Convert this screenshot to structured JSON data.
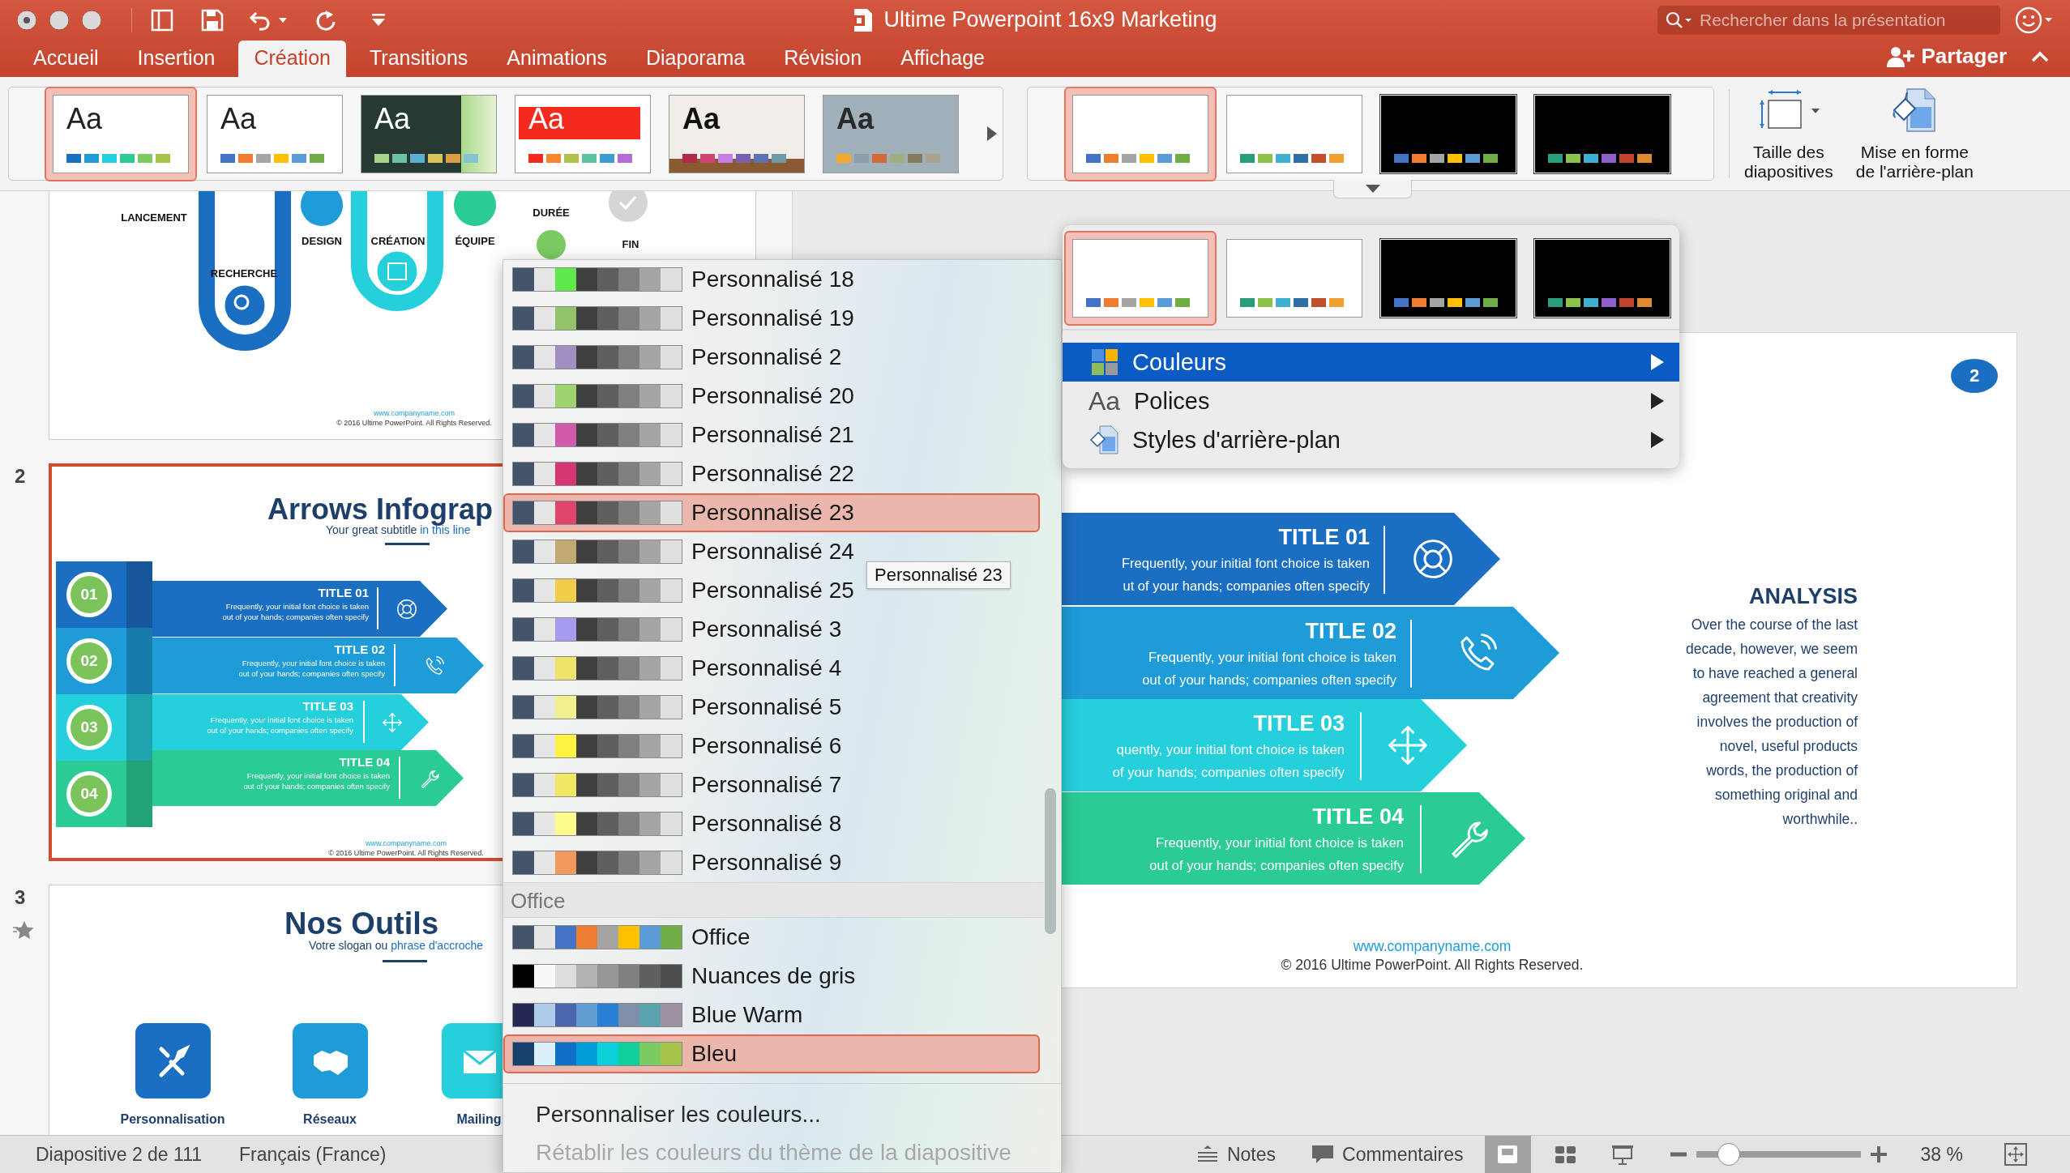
{
  "window": {
    "title": "Ultime Powerpoint 16x9 Marketing",
    "search": {
      "placeholder": "Rechercher dans la présentation"
    }
  },
  "tabs": [
    {
      "label": "Accueil",
      "selected": false
    },
    {
      "label": "Insertion",
      "selected": false
    },
    {
      "label": "Création",
      "selected": true
    },
    {
      "label": "Transitions",
      "selected": false
    },
    {
      "label": "Animations",
      "selected": false
    },
    {
      "label": "Diaporama",
      "selected": false
    },
    {
      "label": "Révision",
      "selected": false
    },
    {
      "label": "Affichage",
      "selected": false
    }
  ],
  "share": {
    "label": "Partager"
  },
  "ribbon": {
    "themes": [
      {
        "label": "Aa",
        "kind": "white",
        "selected": true,
        "swatches": [
          {
            "color": "#1b6fc2"
          },
          {
            "color": "#1e9cd8"
          },
          {
            "color": "#26cfdc"
          },
          {
            "color": "#2acb94"
          },
          {
            "color": "#7cca62"
          },
          {
            "color": "#a5c249"
          }
        ]
      },
      {
        "label": "Aa",
        "kind": "white",
        "selected": false,
        "swatches": [
          {
            "color": "#4472c4"
          },
          {
            "color": "#ed7d31"
          },
          {
            "color": "#a5a5a5"
          },
          {
            "color": "#ffc000"
          },
          {
            "color": "#5b9bd5"
          },
          {
            "color": "#70ad47"
          }
        ]
      },
      {
        "label": "Aa",
        "kind": "dark-green",
        "selected": false,
        "swatches": [
          {
            "color": "#a5d48a"
          },
          {
            "color": "#6ac2a0"
          },
          {
            "color": "#5bb0cf"
          },
          {
            "color": "#d7c55a"
          },
          {
            "color": "#dba046"
          },
          {
            "color": "#84c4d0"
          }
        ]
      },
      {
        "label": "Aa",
        "kind": "red",
        "selected": false,
        "swatches": [
          {
            "color": "#f52a1f"
          },
          {
            "color": "#f88530"
          },
          {
            "color": "#b0c04d"
          },
          {
            "color": "#5bc3a2"
          },
          {
            "color": "#3d9bd3"
          },
          {
            "color": "#b56bd6"
          }
        ]
      },
      {
        "label": "Aa",
        "kind": "beige",
        "selected": false,
        "swatches": [
          {
            "color": "#b22a4b"
          },
          {
            "color": "#d1466f"
          },
          {
            "color": "#c77ee6"
          },
          {
            "color": "#7b5fb0"
          },
          {
            "color": "#5c71b4"
          },
          {
            "color": "#6f98a8"
          }
        ]
      },
      {
        "label": "Aa",
        "kind": "slate",
        "selected": false,
        "swatches": [
          {
            "color": "#f0a830"
          },
          {
            "color": "#8c9eab"
          },
          {
            "color": "#d26a3b"
          },
          {
            "color": "#a0ae84"
          },
          {
            "color": "#857a5c"
          },
          {
            "color": "#a8a18b"
          }
        ]
      }
    ],
    "variants": [
      {
        "kind": "light",
        "selected": true,
        "swatches": [
          {
            "color": "#4472c4"
          },
          {
            "color": "#ed7d31"
          },
          {
            "color": "#a5a5a5"
          },
          {
            "color": "#ffc000"
          },
          {
            "color": "#5b9bd5"
          },
          {
            "color": "#70ad47"
          }
        ]
      },
      {
        "kind": "light",
        "selected": false,
        "swatches": [
          {
            "color": "#2a9d7d"
          },
          {
            "color": "#8bc34a"
          },
          {
            "color": "#3fb0d0"
          },
          {
            "color": "#2f6ea6"
          },
          {
            "color": "#c0502d"
          },
          {
            "color": "#f0a030"
          }
        ]
      },
      {
        "kind": "dark",
        "selected": false,
        "swatches": [
          {
            "color": "#4472c4"
          },
          {
            "color": "#ed7d31"
          },
          {
            "color": "#a5a5a5"
          },
          {
            "color": "#ffc000"
          },
          {
            "color": "#5b9bd5"
          },
          {
            "color": "#70ad47"
          }
        ]
      },
      {
        "kind": "dark",
        "selected": false,
        "swatches": [
          {
            "color": "#2a9d7d"
          },
          {
            "color": "#8bc34a"
          },
          {
            "color": "#3fb0d0"
          },
          {
            "color": "#8d5fc8"
          },
          {
            "color": "#c0442d"
          },
          {
            "color": "#dc8c30"
          }
        ]
      }
    ],
    "buttons": [
      {
        "kind": "slide-size",
        "label": "Taille des\ndiapositives"
      },
      {
        "kind": "background-format",
        "label": "Mise en forme\nde l'arrière-plan"
      }
    ]
  },
  "slides": [
    {
      "kind": "timeline",
      "selected": false,
      "labels": [
        "LANCEMENT",
        "RECHERCHE",
        "DESIGN",
        "CRÉATION",
        "ÉQUIPE",
        "DURÉE",
        "FIN"
      ],
      "footer": {
        "url": "www.companyname.com",
        "copyright": "© 2016 Ultime PowerPoint. All Rights Reserved."
      }
    },
    {
      "kind": "arrows",
      "number": "2",
      "selected": true,
      "title": "Arrows Infograp",
      "subtitle": "Your great subtitle",
      "subtitle_accent": "in this line",
      "rows": [
        {
          "number": "01",
          "title": "TITLE 01",
          "text": "Frequently, your initial font choice is taken\nout of your hands; companies often specify"
        },
        {
          "number": "02",
          "title": "TITLE 02",
          "text": "Frequently, your initial font choice is taken\nout of your hands; companies often specify"
        },
        {
          "number": "03",
          "title": "TITLE 03",
          "text": "Frequently, your initial font choice is taken\nout of your hands; companies often specify"
        },
        {
          "number": "04",
          "title": "TITLE 04",
          "text": "Frequently, your initial font choice is taken\nout of your hands; companies often specify"
        }
      ],
      "footer": {
        "url": "www.companyname.com",
        "copyright": "© 2016 Ultime PowerPoint. All Rights Reserved."
      }
    },
    {
      "kind": "tools",
      "number": "3",
      "selected": false,
      "title": "Nos Outils",
      "subtitle": "Votre slogan ou",
      "subtitle_accent": "phrase d'accroche",
      "tools": [
        {
          "label": "Personnalisation"
        },
        {
          "label": "Réseaux"
        },
        {
          "label": "Mailing"
        }
      ]
    }
  ],
  "slide": {
    "badge": "2",
    "rows": [
      {
        "title": "TITLE 01",
        "text": "Frequently, your initial font choice is taken\nut of your hands; companies often specify"
      },
      {
        "title": "TITLE 02",
        "text": "Frequently, your initial font choice is taken\nout of your hands; companies often specify"
      },
      {
        "title": "TITLE 03",
        "text": "quently, your initial font choice is taken\nof your hands; companies often specify"
      },
      {
        "title": "TITLE 04",
        "text": "Frequently, your initial font choice is taken\nout of your hands; companies often specify"
      }
    ],
    "analysis": {
      "title": "ANALYSIS",
      "text": "Over the course of the last\ndecade, however, we seem\nto have reached a general\nagreement that creativity\ninvolves the production of\nnovel, useful products\nwords, the production of\nsomething original and\nworthwhile.."
    },
    "footer": {
      "url": "www.companyname.com",
      "copyright": "© 2016 Ultime PowerPoint. All Rights Reserved."
    }
  },
  "color_menu": {
    "palettes": [
      {
        "kind": "palette",
        "label": "Personnalisé 18",
        "selected": false,
        "swatches": [
          {
            "color": "#44546a"
          },
          {
            "color": "#e7e6e6"
          },
          {
            "color": "#5ee84c"
          },
          {
            "color": "#404040"
          },
          {
            "color": "#5f5f5f"
          },
          {
            "color": "#808080"
          },
          {
            "color": "#a5a5a5"
          },
          {
            "color": "#e0e0e0"
          }
        ]
      },
      {
        "kind": "palette",
        "label": "Personnalisé 19",
        "selected": false,
        "swatches": [
          {
            "color": "#44546a"
          },
          {
            "color": "#e7e6e6"
          },
          {
            "color": "#92c36a"
          },
          {
            "color": "#404040"
          },
          {
            "color": "#5f5f5f"
          },
          {
            "color": "#808080"
          },
          {
            "color": "#a5a5a5"
          },
          {
            "color": "#e0e0e0"
          }
        ]
      },
      {
        "kind": "palette",
        "label": "Personnalisé 2",
        "selected": false,
        "swatches": [
          {
            "color": "#44546a"
          },
          {
            "color": "#e7e6e6"
          },
          {
            "color": "#a18fc2"
          },
          {
            "color": "#404040"
          },
          {
            "color": "#5f5f5f"
          },
          {
            "color": "#808080"
          },
          {
            "color": "#a5a5a5"
          },
          {
            "color": "#e0e0e0"
          }
        ]
      },
      {
        "kind": "palette",
        "label": "Personnalisé 20",
        "selected": false,
        "swatches": [
          {
            "color": "#44546a"
          },
          {
            "color": "#e7e6e6"
          },
          {
            "color": "#9ed36f"
          },
          {
            "color": "#404040"
          },
          {
            "color": "#5f5f5f"
          },
          {
            "color": "#808080"
          },
          {
            "color": "#a5a5a5"
          },
          {
            "color": "#e0e0e0"
          }
        ]
      },
      {
        "kind": "palette",
        "label": "Personnalisé 21",
        "selected": false,
        "swatches": [
          {
            "color": "#44546a"
          },
          {
            "color": "#e7e6e6"
          },
          {
            "color": "#d25aad"
          },
          {
            "color": "#404040"
          },
          {
            "color": "#5f5f5f"
          },
          {
            "color": "#808080"
          },
          {
            "color": "#a5a5a5"
          },
          {
            "color": "#e0e0e0"
          }
        ]
      },
      {
        "kind": "palette",
        "label": "Personnalisé 22",
        "selected": false,
        "swatches": [
          {
            "color": "#44546a"
          },
          {
            "color": "#e7e6e6"
          },
          {
            "color": "#d63672"
          },
          {
            "color": "#404040"
          },
          {
            "color": "#5f5f5f"
          },
          {
            "color": "#808080"
          },
          {
            "color": "#a5a5a5"
          },
          {
            "color": "#e0e0e0"
          }
        ]
      },
      {
        "kind": "palette",
        "label": "Personnalisé 23",
        "selected": true,
        "swatches": [
          {
            "color": "#44546a"
          },
          {
            "color": "#e7e6e6"
          },
          {
            "color": "#e2456b"
          },
          {
            "color": "#404040"
          },
          {
            "color": "#5f5f5f"
          },
          {
            "color": "#808080"
          },
          {
            "color": "#a5a5a5"
          },
          {
            "color": "#e0e0e0"
          }
        ]
      },
      {
        "kind": "palette",
        "label": "Personnalisé 24",
        "selected": false,
        "swatches": [
          {
            "color": "#44546a"
          },
          {
            "color": "#e7e6e6"
          },
          {
            "color": "#c1a970"
          },
          {
            "color": "#404040"
          },
          {
            "color": "#5f5f5f"
          },
          {
            "color": "#808080"
          },
          {
            "color": "#a5a5a5"
          },
          {
            "color": "#e0e0e0"
          }
        ]
      },
      {
        "kind": "palette",
        "label": "Personnalisé 25",
        "selected": false,
        "swatches": [
          {
            "color": "#44546a"
          },
          {
            "color": "#e7e6e6"
          },
          {
            "color": "#f2cd4a"
          },
          {
            "color": "#404040"
          },
          {
            "color": "#5f5f5f"
          },
          {
            "color": "#808080"
          },
          {
            "color": "#a5a5a5"
          },
          {
            "color": "#e0e0e0"
          }
        ]
      },
      {
        "kind": "palette",
        "label": "Personnalisé 3",
        "selected": false,
        "swatches": [
          {
            "color": "#44546a"
          },
          {
            "color": "#e7e6e6"
          },
          {
            "color": "#a59cf0"
          },
          {
            "color": "#404040"
          },
          {
            "color": "#5f5f5f"
          },
          {
            "color": "#808080"
          },
          {
            "color": "#a5a5a5"
          },
          {
            "color": "#e0e0e0"
          }
        ]
      },
      {
        "kind": "palette",
        "label": "Personnalisé 4",
        "selected": false,
        "swatches": [
          {
            "color": "#44546a"
          },
          {
            "color": "#e7e6e6"
          },
          {
            "color": "#eee46c"
          },
          {
            "color": "#404040"
          },
          {
            "color": "#5f5f5f"
          },
          {
            "color": "#808080"
          },
          {
            "color": "#a5a5a5"
          },
          {
            "color": "#e0e0e0"
          }
        ]
      },
      {
        "kind": "palette",
        "label": "Personnalisé 5",
        "selected": false,
        "swatches": [
          {
            "color": "#44546a"
          },
          {
            "color": "#e7e6e6"
          },
          {
            "color": "#f0f08e"
          },
          {
            "color": "#404040"
          },
          {
            "color": "#5f5f5f"
          },
          {
            "color": "#808080"
          },
          {
            "color": "#a5a5a5"
          },
          {
            "color": "#e0e0e0"
          }
        ]
      },
      {
        "kind": "palette",
        "label": "Personnalisé 6",
        "selected": false,
        "swatches": [
          {
            "color": "#44546a"
          },
          {
            "color": "#e7e6e6"
          },
          {
            "color": "#fef243"
          },
          {
            "color": "#404040"
          },
          {
            "color": "#5f5f5f"
          },
          {
            "color": "#808080"
          },
          {
            "color": "#a5a5a5"
          },
          {
            "color": "#e0e0e0"
          }
        ]
      },
      {
        "kind": "palette",
        "label": "Personnalisé 7",
        "selected": false,
        "swatches": [
          {
            "color": "#44546a"
          },
          {
            "color": "#e7e6e6"
          },
          {
            "color": "#f0e862"
          },
          {
            "color": "#404040"
          },
          {
            "color": "#5f5f5f"
          },
          {
            "color": "#808080"
          },
          {
            "color": "#a5a5a5"
          },
          {
            "color": "#e0e0e0"
          }
        ]
      },
      {
        "kind": "palette",
        "label": "Personnalisé 8",
        "selected": false,
        "swatches": [
          {
            "color": "#44546a"
          },
          {
            "color": "#e7e6e6"
          },
          {
            "color": "#fdfb8c"
          },
          {
            "color": "#404040"
          },
          {
            "color": "#5f5f5f"
          },
          {
            "color": "#808080"
          },
          {
            "color": "#a5a5a5"
          },
          {
            "color": "#e0e0e0"
          }
        ]
      },
      {
        "kind": "palette",
        "label": "Personnalisé 9",
        "selected": false,
        "swatches": [
          {
            "color": "#44546a"
          },
          {
            "color": "#e7e6e6"
          },
          {
            "color": "#f2985a"
          },
          {
            "color": "#404040"
          },
          {
            "color": "#5f5f5f"
          },
          {
            "color": "#808080"
          },
          {
            "color": "#a5a5a5"
          },
          {
            "color": "#e0e0e0"
          }
        ]
      },
      {
        "kind": "header",
        "label": "Office"
      },
      {
        "kind": "palette",
        "label": "Office",
        "selected": false,
        "swatches": [
          {
            "color": "#44546a"
          },
          {
            "color": "#e7e6e6"
          },
          {
            "color": "#4472c4"
          },
          {
            "color": "#ed7d31"
          },
          {
            "color": "#a5a5a5"
          },
          {
            "color": "#ffc000"
          },
          {
            "color": "#5b9bd5"
          },
          {
            "color": "#70ad47"
          }
        ]
      },
      {
        "kind": "palette",
        "label": "Nuances de gris",
        "selected": false,
        "swatches": [
          {
            "color": "#000000"
          },
          {
            "color": "#f8f8f8"
          },
          {
            "color": "#dddddd"
          },
          {
            "color": "#b2b2b2"
          },
          {
            "color": "#969696"
          },
          {
            "color": "#808080"
          },
          {
            "color": "#5f5f5f"
          },
          {
            "color": "#4d4d4d"
          }
        ]
      },
      {
        "kind": "palette",
        "label": "Blue Warm",
        "selected": false,
        "swatches": [
          {
            "color": "#242852"
          },
          {
            "color": "#acccea"
          },
          {
            "color": "#4a66ac"
          },
          {
            "color": "#629dd1"
          },
          {
            "color": "#297fd5"
          },
          {
            "color": "#7f8fa9"
          },
          {
            "color": "#5aa2ae"
          },
          {
            "color": "#9d90a0"
          }
        ]
      },
      {
        "kind": "palette",
        "label": "Bleu",
        "selected": true,
        "swatches": [
          {
            "color": "#17406d"
          },
          {
            "color": "#dbeff9"
          },
          {
            "color": "#0f6fc6"
          },
          {
            "color": "#009dd9"
          },
          {
            "color": "#0bd0d9"
          },
          {
            "color": "#10cf9b"
          },
          {
            "color": "#7cca62"
          },
          {
            "color": "#a5c249"
          }
        ]
      }
    ],
    "tooltip": "Personnalisé 23",
    "actions": [
      {
        "label": "Personnaliser les couleurs...",
        "disabled": false
      },
      {
        "label": "Rétablir les couleurs du thème de la diapositive",
        "disabled": true
      }
    ]
  },
  "design_menu": {
    "variants": [
      {
        "kind": "light",
        "selected": true,
        "swatches": [
          {
            "color": "#4472c4"
          },
          {
            "color": "#ed7d31"
          },
          {
            "color": "#a5a5a5"
          },
          {
            "color": "#ffc000"
          },
          {
            "color": "#5b9bd5"
          },
          {
            "color": "#70ad47"
          }
        ]
      },
      {
        "kind": "light",
        "selected": false,
        "swatches": [
          {
            "color": "#2a9d7d"
          },
          {
            "color": "#8bc34a"
          },
          {
            "color": "#3fb0d0"
          },
          {
            "color": "#2f6ea6"
          },
          {
            "color": "#c0502d"
          },
          {
            "color": "#f0a030"
          }
        ]
      },
      {
        "kind": "dark",
        "selected": false,
        "swatches": [
          {
            "color": "#4472c4"
          },
          {
            "color": "#ed7d31"
          },
          {
            "color": "#a5a5a5"
          },
          {
            "color": "#ffc000"
          },
          {
            "color": "#5b9bd5"
          },
          {
            "color": "#70ad47"
          }
        ]
      },
      {
        "kind": "dark",
        "selected": false,
        "swatches": [
          {
            "color": "#2a9d7d"
          },
          {
            "color": "#8bc34a"
          },
          {
            "color": "#3fb0d0"
          },
          {
            "color": "#8d5fc8"
          },
          {
            "color": "#c0442d"
          },
          {
            "color": "#dc8c30"
          }
        ]
      }
    ],
    "items": [
      {
        "kind": "colors",
        "label": "Couleurs",
        "selected": true
      },
      {
        "kind": "fonts",
        "glyph": "Aa",
        "label": "Polices",
        "selected": false
      },
      {
        "kind": "background",
        "label": "Styles d'arrière-plan",
        "selected": false
      }
    ]
  },
  "status_bar": {
    "slide_info": "Diapositive 2 de 111",
    "language": "Français (France)",
    "notes": "Notes",
    "comments": "Commentaires",
    "views": [
      {
        "kind": "normal",
        "selected": true
      },
      {
        "kind": "sorter",
        "selected": false
      },
      {
        "kind": "presenter",
        "selected": false
      }
    ],
    "zoom": {
      "level": 0.2
    },
    "zoom_label": "38 %"
  }
}
